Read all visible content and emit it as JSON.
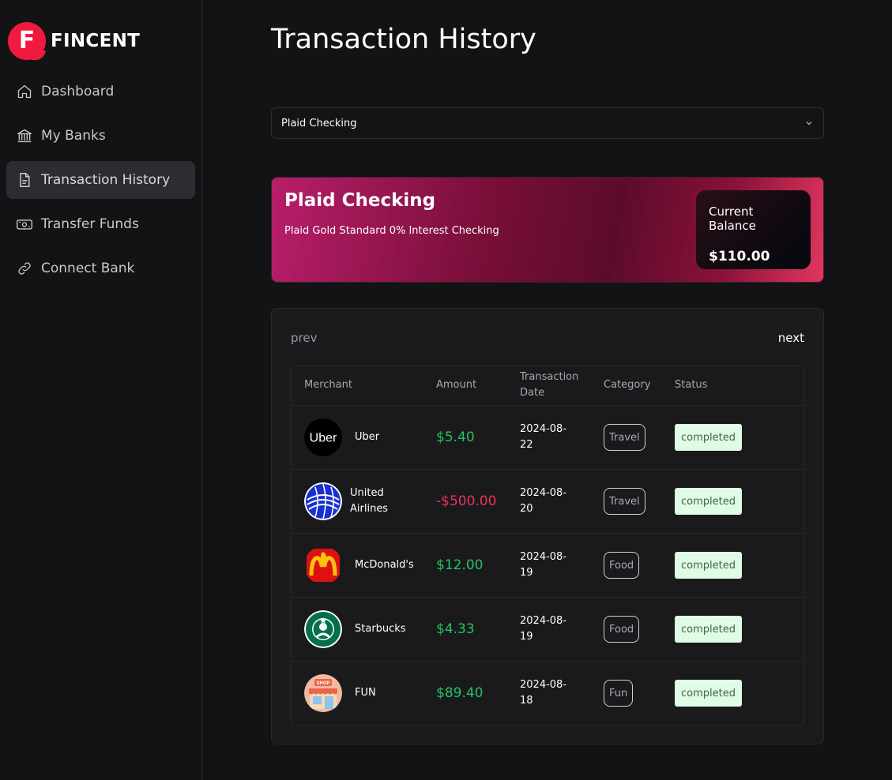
{
  "brand": {
    "logo_letter": "F",
    "name": "FINCENT",
    "color": "#f0193f"
  },
  "sidebar": {
    "items": [
      {
        "label": "Dashboard",
        "icon": "home-icon",
        "active": false
      },
      {
        "label": "My Banks",
        "icon": "bank-icon",
        "active": false
      },
      {
        "label": "Transaction History",
        "icon": "document-icon",
        "active": true
      },
      {
        "label": "Transfer Funds",
        "icon": "money-icon",
        "active": false
      },
      {
        "label": "Connect Bank",
        "icon": "link-icon",
        "active": false
      }
    ]
  },
  "page": {
    "title": "Transaction History"
  },
  "account_select": {
    "value": "Plaid Checking",
    "icon": "chevron-down-icon"
  },
  "bank_card": {
    "name": "Plaid Checking",
    "subtitle": "Plaid Gold Standard 0% Interest Checking",
    "balance_label": "Current Balance",
    "balance_value": "$110.00"
  },
  "pager": {
    "prev": "prev",
    "next": "next"
  },
  "table": {
    "headers": {
      "merchant": "Merchant",
      "amount": "Amount",
      "date": "Transaction Date",
      "category": "Category",
      "status": "Status"
    },
    "rows": [
      {
        "merchant": "Uber",
        "logo": "uber-logo",
        "amount": "$5.40",
        "amount_sign": "positive",
        "date": "2024-08-22",
        "category": "Travel",
        "status": "completed"
      },
      {
        "merchant": "United Airlines",
        "logo": "united-airlines-logo",
        "amount": "-$500.00",
        "amount_sign": "negative",
        "date": "2024-08-20",
        "category": "Travel",
        "status": "completed"
      },
      {
        "merchant": "McDonald's",
        "logo": "mcdonalds-logo",
        "amount": "$12.00",
        "amount_sign": "positive",
        "date": "2024-08-19",
        "category": "Food",
        "status": "completed"
      },
      {
        "merchant": "Starbucks",
        "logo": "starbucks-logo",
        "amount": "$4.33",
        "amount_sign": "positive",
        "date": "2024-08-19",
        "category": "Food",
        "status": "completed"
      },
      {
        "merchant": "FUN",
        "logo": "shop-logo",
        "amount": "$89.40",
        "amount_sign": "positive",
        "date": "2024-08-18",
        "category": "Fun",
        "status": "completed"
      }
    ]
  },
  "colors": {
    "positive": "#22c55e",
    "negative": "#e8345a",
    "status_bg": "#e0fbe6"
  }
}
